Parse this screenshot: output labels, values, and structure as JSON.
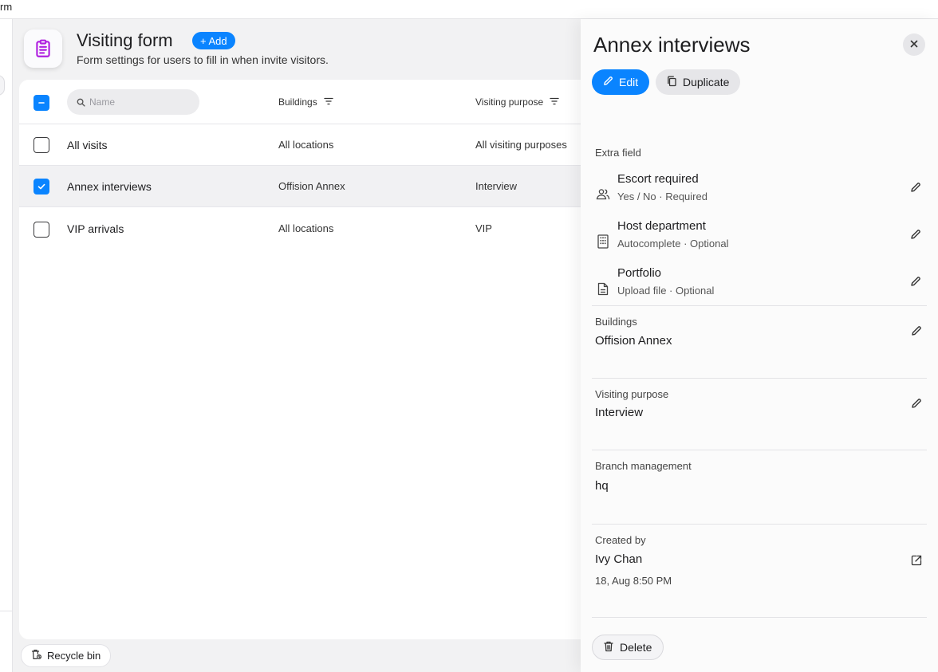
{
  "window": {
    "title_fragment": "rm"
  },
  "header": {
    "title": "Visiting form",
    "add_label": "+ Add",
    "subtitle": "Form settings for users to fill in when invite visitors."
  },
  "table": {
    "search_placeholder": "Name",
    "columns": [
      "Buildings",
      "Visiting purpose"
    ],
    "rows": [
      {
        "name": "All visits",
        "buildings": "All locations",
        "purpose": "All visiting purposes",
        "checked": false
      },
      {
        "name": "Annex interviews",
        "buildings": "Offision Annex",
        "purpose": "Interview",
        "checked": true
      },
      {
        "name": "VIP arrivals",
        "buildings": "All locations",
        "purpose": "VIP",
        "checked": false
      }
    ]
  },
  "footer": {
    "recycle_label": "Recycle bin"
  },
  "panel": {
    "title": "Annex interviews",
    "edit_label": "Edit",
    "duplicate_label": "Duplicate",
    "extra_field_label": "Extra field",
    "extra_fields": [
      {
        "title": "Escort required",
        "sub": "Yes / No · Required",
        "icon": "people-icon"
      },
      {
        "title": "Host department",
        "sub": "Autocomplete · Optional",
        "icon": "building-icon"
      },
      {
        "title": "Portfolio",
        "sub": "Upload file · Optional",
        "icon": "document-icon"
      }
    ],
    "buildings_label": "Buildings",
    "buildings_value": "Offision Annex",
    "purpose_label": "Visiting purpose",
    "purpose_value": "Interview",
    "branch_label": "Branch management",
    "branch_value": "hq",
    "created_label": "Created by",
    "created_by": "Ivy Chan",
    "created_at": "18, Aug 8:50 PM",
    "delete_label": "Delete"
  },
  "colors": {
    "accent": "#0a84ff",
    "app_icon": "#b020e0"
  }
}
